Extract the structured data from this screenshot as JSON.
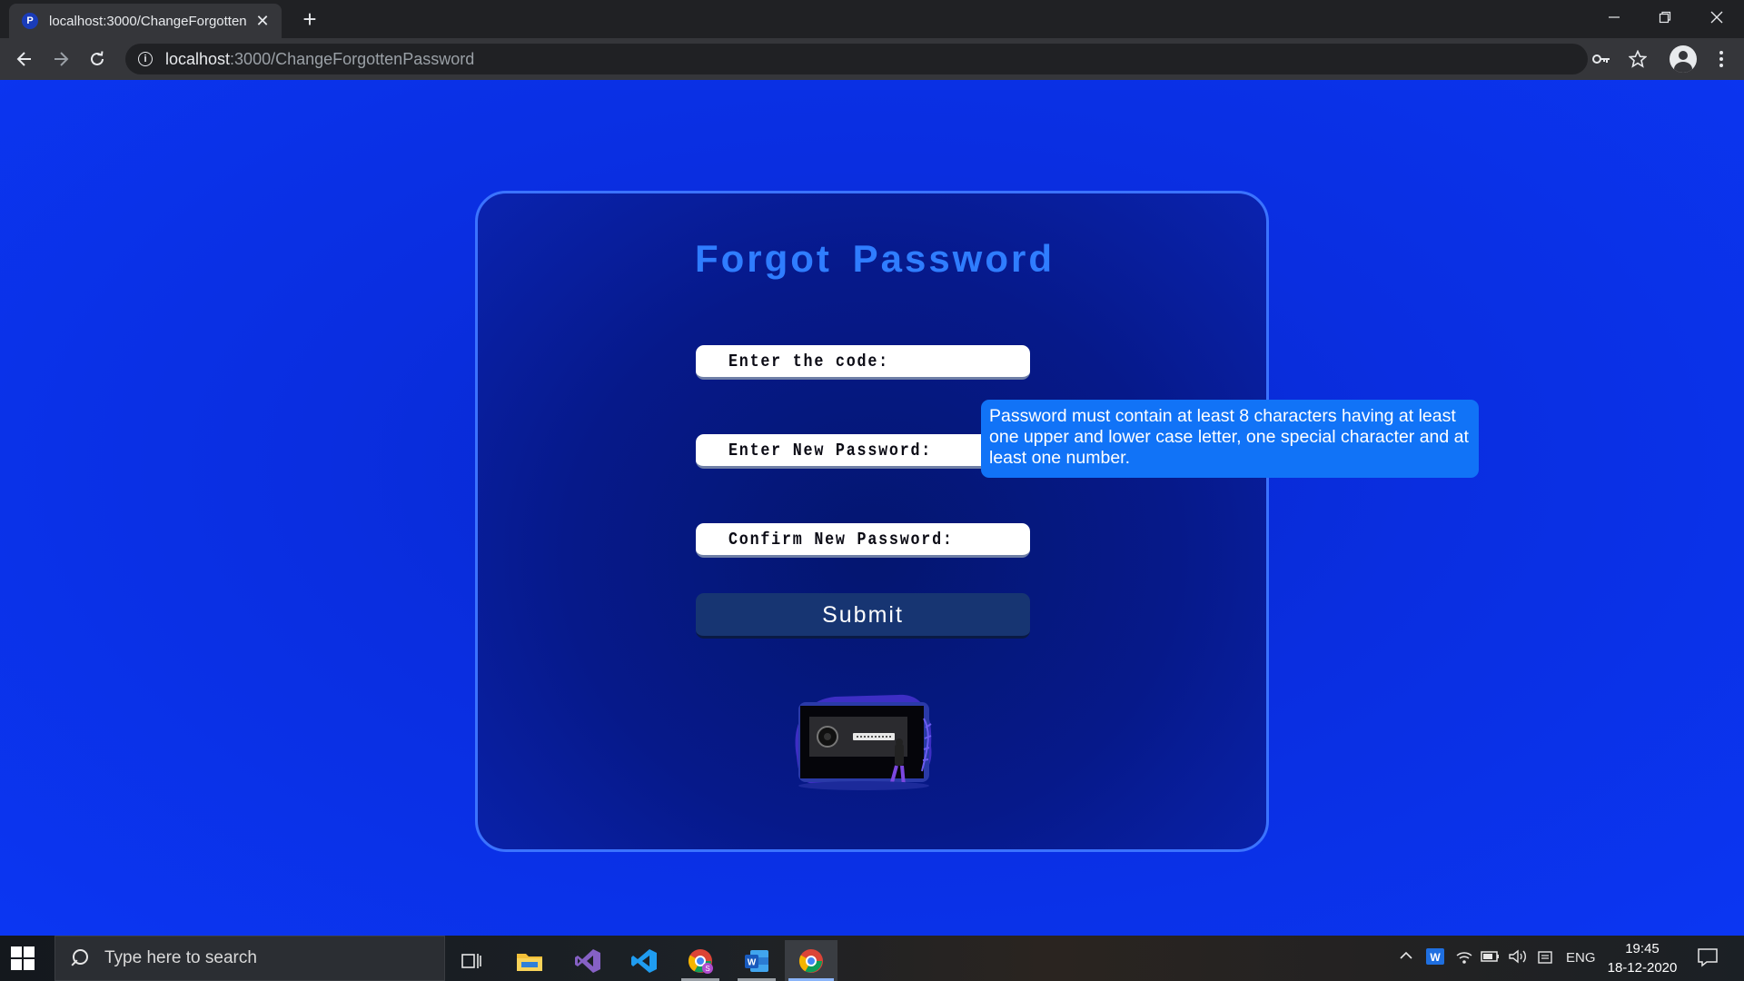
{
  "browser": {
    "tab_title": "localhost:3000/ChangeForgotten",
    "tab_favicon": "P",
    "new_tab": "+",
    "close_tab": "✕",
    "url_host": "localhost",
    "url_path": ":3000/ChangeForgottenPassword"
  },
  "page": {
    "title": "Forgot Password",
    "code_label": "Enter the code:",
    "new_password_label": "Enter New Password:",
    "confirm_password_label": "Confirm New Password:",
    "submit_label": "Submit",
    "tooltip": "Password must contain at least 8 characters having at least one upper and lower case letter, one special character and at least one number."
  },
  "taskbar": {
    "search_placeholder": "Type here to search",
    "language": "ENG",
    "time": "19:45",
    "date": "18-12-2020",
    "pinned": [
      "task-view",
      "file-explorer",
      "visual-studio",
      "vs-code",
      "chrome-profile",
      "word",
      "chrome"
    ]
  },
  "colors": {
    "page_bg": "#0a2ee0",
    "card_border": "#3b73ff",
    "title": "#2f7dff",
    "submit_bg": "#173572",
    "tooltip_bg": "#1173f7"
  }
}
